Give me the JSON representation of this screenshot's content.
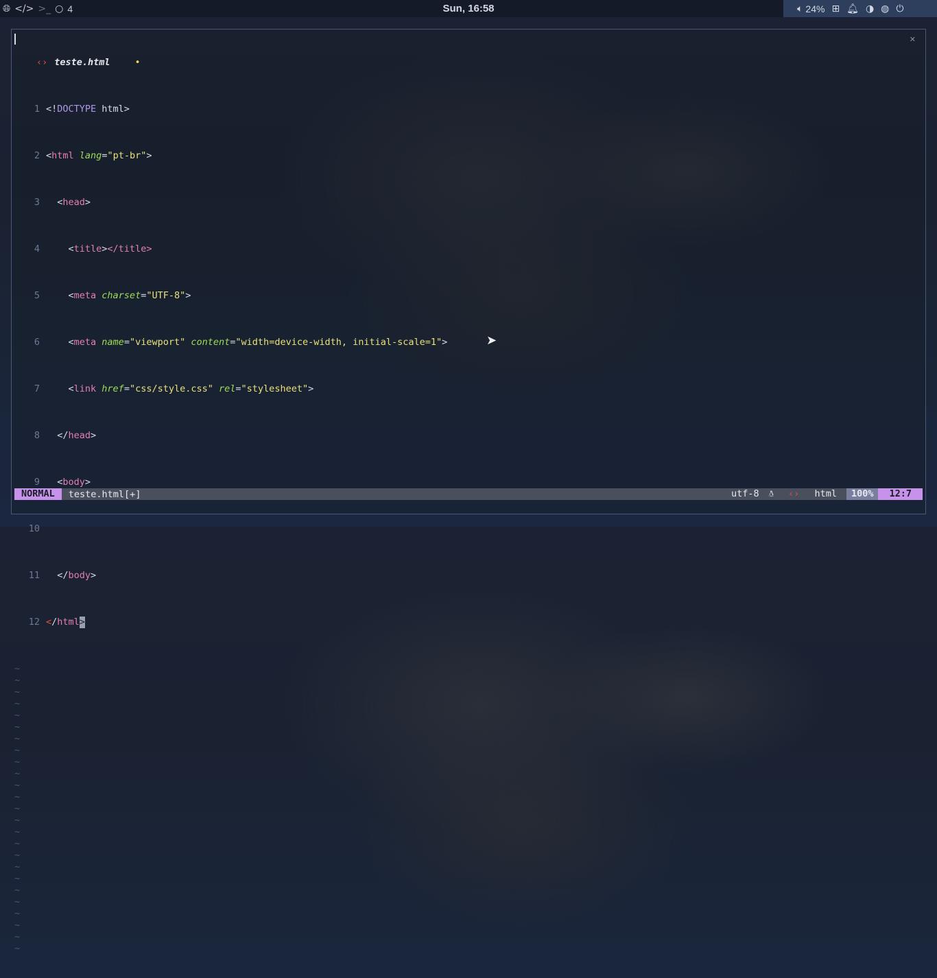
{
  "topbar": {
    "workspace_icons": [
      "globe-icon",
      "code-icon",
      "terminal-icon"
    ],
    "workspace_count": "4",
    "clock": "Sun, 16:58",
    "volume": "24%",
    "status_icons": [
      "volume-icon",
      "network-icon",
      "bell-icon",
      "toggle-icon",
      "palette-icon",
      "power-icon"
    ]
  },
  "editor": {
    "tab_filename": "teste.html",
    "tab_modified_marker": "•",
    "lines": [
      {
        "num": "1"
      },
      {
        "num": "2"
      },
      {
        "num": "3"
      },
      {
        "num": "4"
      },
      {
        "num": "5"
      },
      {
        "num": "6"
      },
      {
        "num": "7"
      },
      {
        "num": "8"
      },
      {
        "num": "9"
      },
      {
        "num": "10"
      },
      {
        "num": "11"
      },
      {
        "num": "12"
      }
    ],
    "code": {
      "l1a": "<!",
      "l1b": "DOCTYPE",
      "l1c": " html>",
      "l2_tag": "html",
      "l2_attr": "lang",
      "l2_val": "\"pt-br\"",
      "l3_tag": "head",
      "l4_tag": "title",
      "l4_close": "</title>",
      "l5_tag": "meta",
      "l5_attr": "charset",
      "l5_val": "\"UTF-8\"",
      "l6_tag": "meta",
      "l6_attr1": "name",
      "l6_val1": "\"viewport\"",
      "l6_attr2": "content",
      "l6_val2": "\"width=device-width, initial-scale=1\"",
      "l7_tag": "link",
      "l7_attr1": "href",
      "l7_val1": "\"css/style.css\"",
      "l7_attr2": "rel",
      "l7_val2": "\"stylesheet\"",
      "l8_tag": "head",
      "l9_tag": "body",
      "l11_tag": "body",
      "l12_tag": "html"
    },
    "tilde": "~"
  },
  "statusline": {
    "mode": "NORMAL",
    "file": "teste.html[+]",
    "encoding": "utf-8",
    "os_icon": "linux-icon",
    "filetype": "html",
    "percent": "100%",
    "position": "12:7"
  }
}
